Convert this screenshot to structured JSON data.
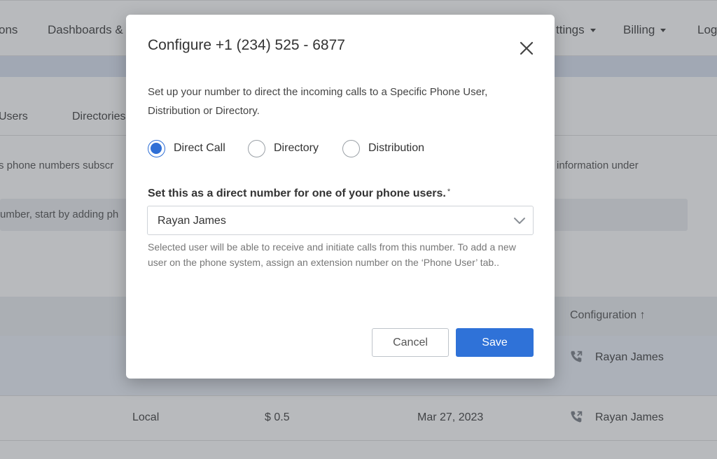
{
  "background": {
    "nav": {
      "items": [
        {
          "label": "ons"
        },
        {
          "label": "Dashboards &"
        },
        {
          "label": "ttings"
        },
        {
          "label": "Billing"
        },
        {
          "label": "Log"
        }
      ]
    },
    "tabs": [
      {
        "label": "Users"
      },
      {
        "label": "Directories"
      }
    ],
    "description_left": "s phone numbers subscr",
    "description_right": "information under",
    "notice_text": "umber, start by adding ph",
    "table": {
      "header_configuration": "Configuration",
      "sort_indicator": "↑",
      "rows": [
        {
          "type": "",
          "price": "",
          "date": "",
          "configuration": "Rayan James"
        },
        {
          "type": "Local",
          "price": "$ 0.5",
          "date": "Mar 27, 2023",
          "configuration": "Rayan James"
        }
      ]
    }
  },
  "modal": {
    "title": "Configure +1 (234) 525 - 6877",
    "close_icon": "close-icon",
    "intro": "Set up your number to direct the incoming calls to a Specific Phone User, Distribution or Directory.",
    "routing_options": [
      {
        "label": "Direct Call",
        "selected": true
      },
      {
        "label": "Directory",
        "selected": false
      },
      {
        "label": "Distribution",
        "selected": false
      }
    ],
    "field_label": "Set this as a direct number for one of your phone users.",
    "required_mark": "*",
    "selected_user": "Rayan James",
    "help_text": "Selected user will be able to receive and initiate calls from this number. To add a new user on the phone system, assign an extension number on the ‘Phone User’ tab..",
    "cancel_label": "Cancel",
    "save_label": "Save"
  },
  "colors": {
    "accent": "#2f72d8",
    "radio_selected": "#2f6fd6",
    "overlay": "rgba(20,26,38,0.30)"
  }
}
